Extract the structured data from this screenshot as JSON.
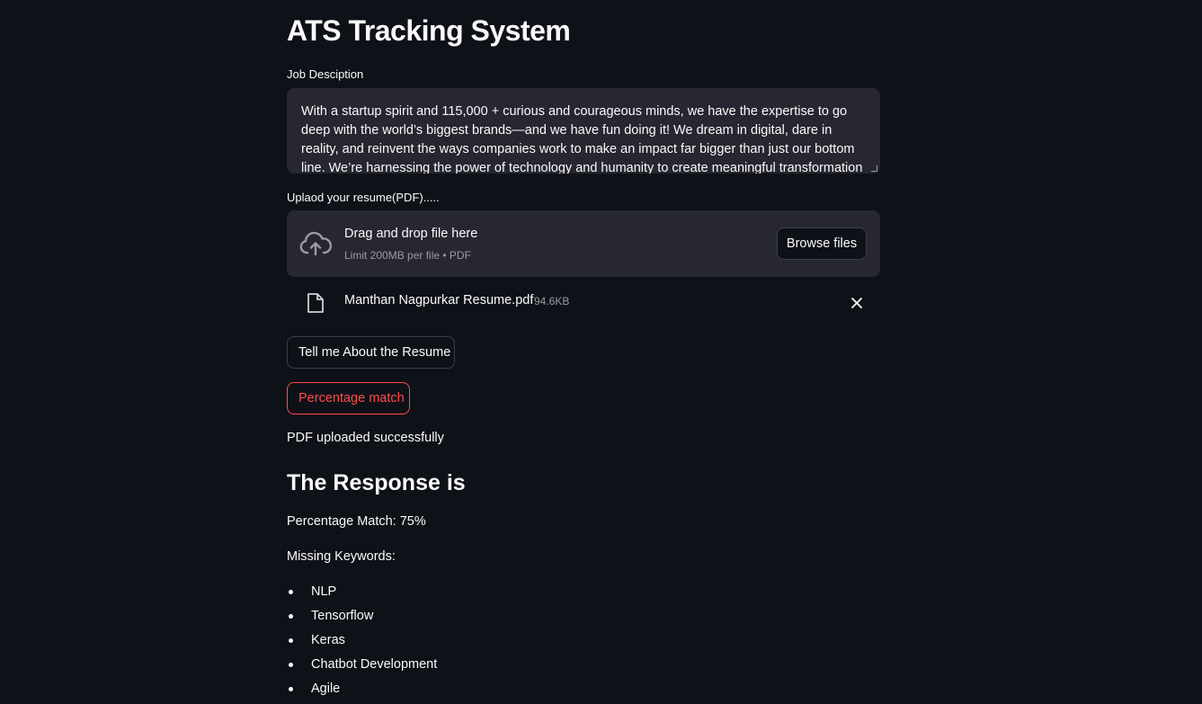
{
  "app": {
    "title": "ATS Tracking System"
  },
  "job_description": {
    "label": "Job Desciption",
    "value": "With a startup spirit and 115,000 + curious and courageous minds, we have the expertise to go deep with the world’s biggest brands—and we have fun doing it! We dream in digital, dare in reality, and reinvent the ways companies work to make an impact far bigger than just our bottom line. We’re harnessing the power of technology and humanity to create meaningful transformation that moves"
  },
  "uploader": {
    "label": "Uplaod your resume(PDF).....",
    "drop_title": "Drag and drop file here",
    "drop_subtitle": "Limit 200MB per file • PDF",
    "browse_label": "Browse files",
    "file": {
      "name": "Manthan Nagpurkar Resume.pdf",
      "size": "94.6KB"
    }
  },
  "buttons": {
    "about_label": "Tell me About the Resume",
    "match_label": "Percentage match"
  },
  "status": {
    "upload_message": "PDF uploaded successfully"
  },
  "response": {
    "heading": "The Response is",
    "percentage_line": "Percentage Match: 75%",
    "missing_label": "Missing Keywords:",
    "keywords": [
      "NLP",
      "Tensorflow",
      "Keras",
      "Chatbot Development",
      "Agile"
    ]
  },
  "colors": {
    "background": "#0e1117",
    "surface": "#262730",
    "accent": "#ff4b4b",
    "text": "#fafafa",
    "muted": "#9a9aa3"
  },
  "icons": {
    "upload": "cloud-upload-icon",
    "file": "file-icon",
    "remove": "close-icon"
  }
}
